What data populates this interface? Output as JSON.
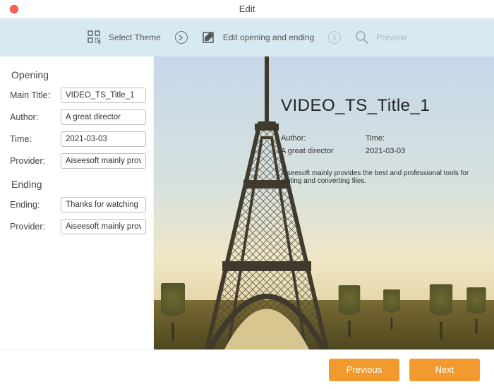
{
  "window": {
    "title": "Edit"
  },
  "steps": {
    "select_theme": "Select Theme",
    "edit_opening": "Edit opening and ending",
    "preview": "Preview"
  },
  "form": {
    "opening_header": "Opening",
    "ending_header": "Ending",
    "labels": {
      "main_title": "Main Title:",
      "author": "Author:",
      "time": "Time:",
      "provider": "Provider:",
      "ending": "Ending:"
    },
    "values": {
      "main_title": "VIDEO_TS_Title_1",
      "author": "A great director",
      "time": "2021-03-03",
      "provider_opening": "Aiseesoft mainly provides the best and professional tools for editing and converting files.",
      "ending": "Thanks for watching",
      "provider_ending": "Aiseesoft mainly provides the best and professional tools for editing and converting files."
    }
  },
  "preview": {
    "title": "VIDEO_TS_Title_1",
    "author_label": "Author:",
    "time_label": "Time:",
    "author_value": "A great director",
    "time_value": "2021-03-03",
    "provider_text": "Aiseesoft mainly provides the best and professional tools for editing and converting files."
  },
  "footer": {
    "previous": "Previous",
    "next": "Next"
  }
}
